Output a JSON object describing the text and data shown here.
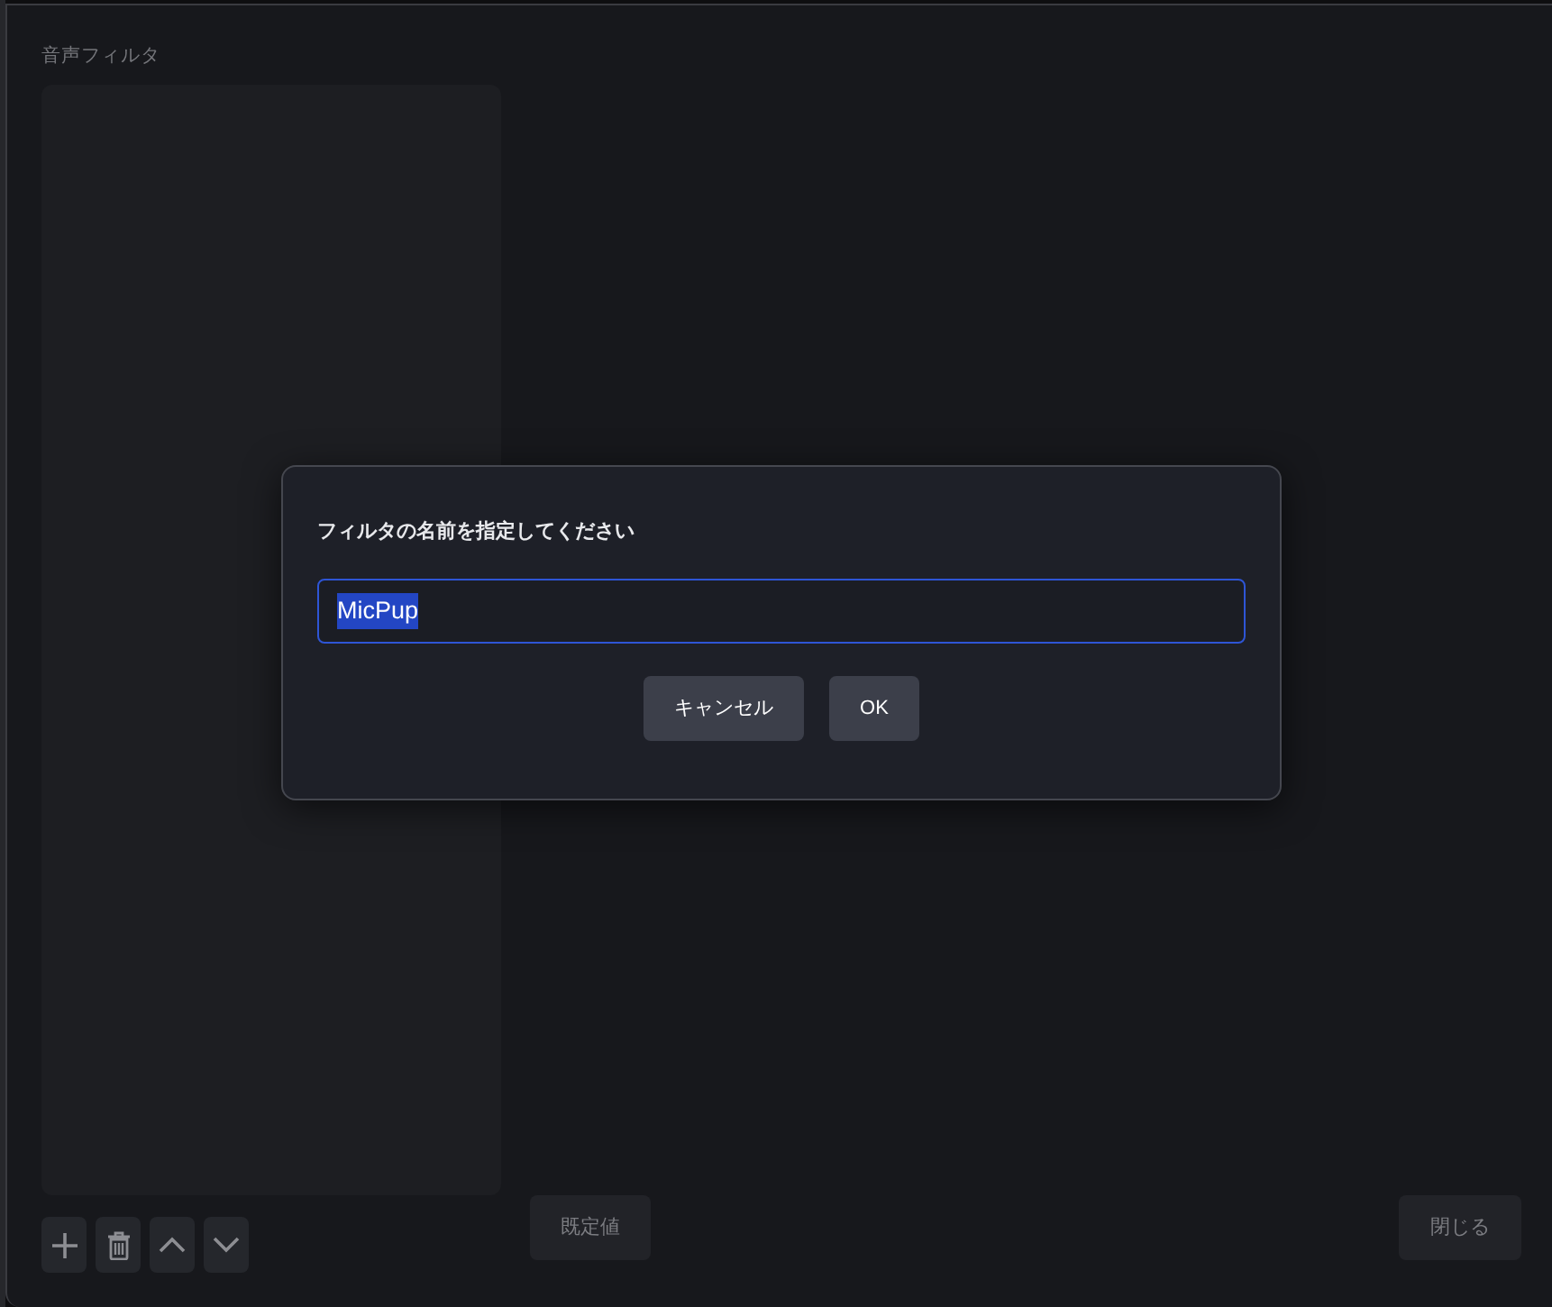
{
  "panel": {
    "label": "音声フィルタ"
  },
  "footer": {
    "defaults_button": {
      "label": "既定値"
    },
    "close_button": {
      "label": "閉じる"
    }
  },
  "dialog": {
    "prompt": "フィルタの名前を指定してください",
    "input": {
      "value": "MicPup",
      "value_selected": true
    },
    "buttons": [
      {
        "label": "キャンセル"
      },
      {
        "label": "OK"
      }
    ]
  }
}
